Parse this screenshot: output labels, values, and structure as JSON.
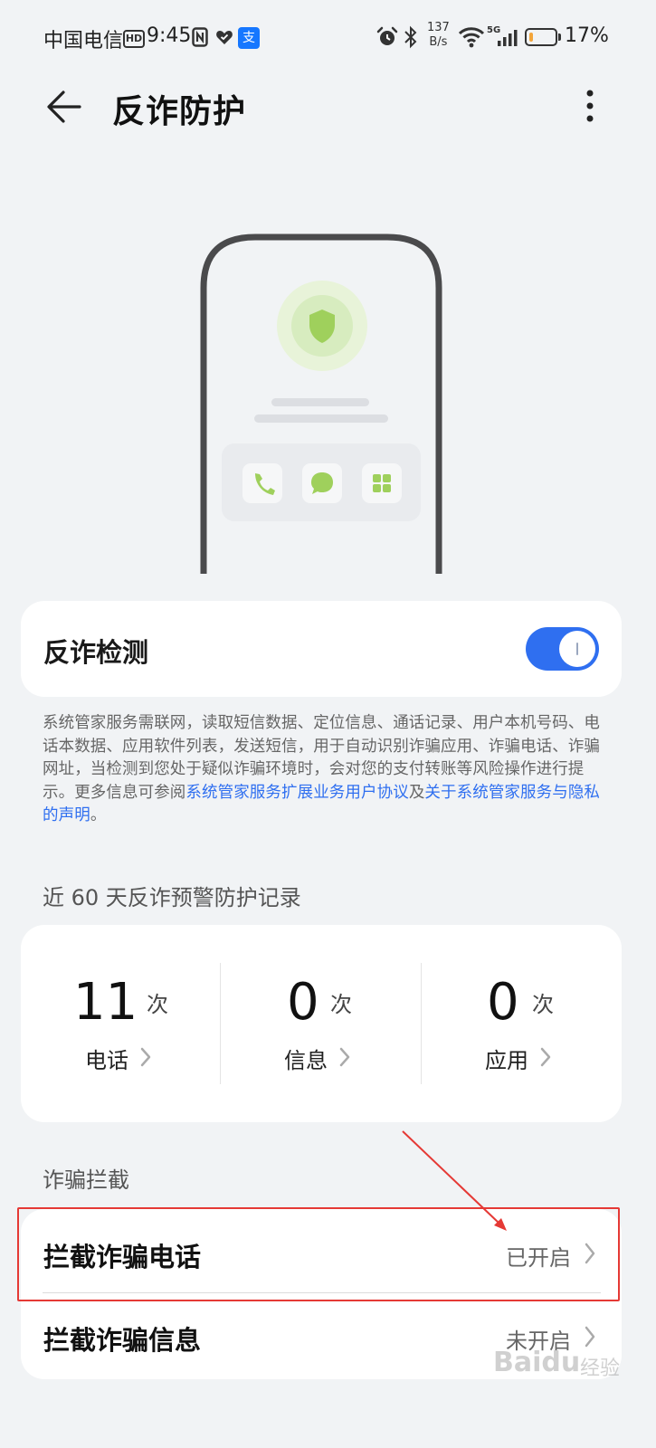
{
  "status_bar": {
    "carrier": "中国电信",
    "hd": "HD",
    "time": "9:45",
    "pay_glyph": "支",
    "net_speed_value": "137",
    "net_speed_unit": "B/s",
    "network": "5G",
    "battery_percent": 17,
    "battery_text": "17%",
    "icons": [
      "nfc-icon",
      "heart-icon",
      "alipay-icon",
      "alarm-icon",
      "bluetooth-icon",
      "wifi-icon",
      "signal-icon",
      "battery-icon"
    ]
  },
  "header": {
    "title": "反诈防护"
  },
  "detection": {
    "label": "反诈检测",
    "enabled": true,
    "accent_color": "#2f6ff0",
    "desc_prefix": "系统管家服务需联网，读取短信数据、定位信息、通话记录、用户本机号码、电话本数据、应用软件列表，发送短信，用于自动识别诈骗应用、诈骗电话、诈骗网址，当检测到您处于疑似诈骗环境时，会对您的支付转账等风险操作进行提示。更多信息可参阅",
    "link1": "系统管家服务扩展业务用户协议",
    "desc_mid": "及",
    "link2": "关于系统管家服务与隐私的声明",
    "desc_suffix": "。"
  },
  "records": {
    "heading": "近 60 天反诈预警防护记录",
    "items": [
      {
        "count": "11",
        "unit": "次",
        "label": "电话"
      },
      {
        "count": "0",
        "unit": "次",
        "label": "信息"
      },
      {
        "count": "0",
        "unit": "次",
        "label": "应用"
      }
    ]
  },
  "interception": {
    "heading": "诈骗拦截",
    "rows": [
      {
        "label": "拦截诈骗电话",
        "value": "已开启"
      },
      {
        "label": "拦截诈骗信息",
        "value": "未开启"
      }
    ]
  },
  "annotation_color": "#e53935",
  "watermark": {
    "brand": "Baidu",
    "sub": "经验"
  }
}
